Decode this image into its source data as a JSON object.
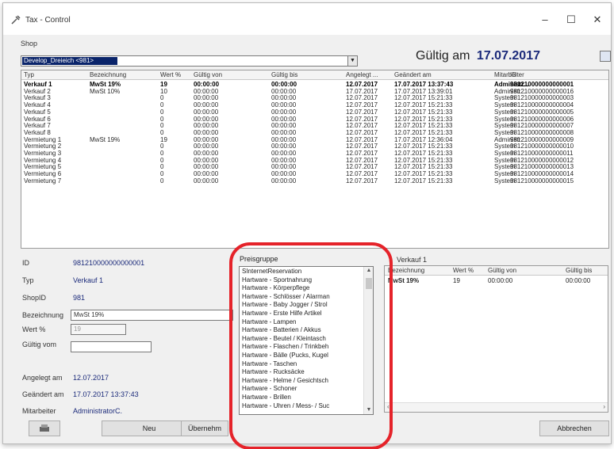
{
  "window": {
    "title": "Tax - Control",
    "minimize": "–",
    "maximize": "☐",
    "close": "✕"
  },
  "shop": {
    "label": "Shop",
    "selected": "Develop_Dreieich <981>"
  },
  "valid": {
    "label": "Gültig am",
    "date": "17.07.2017"
  },
  "grid": {
    "headers": [
      "Typ",
      "Bezeichnung",
      "Wert %",
      "Gültig von",
      "Gültig bis",
      "Angelegt ...",
      "Geändert am",
      "Mitarbeiter",
      "ID"
    ],
    "rows": [
      [
        "Verkauf 1",
        "MwSt 19%",
        "19",
        "00:00:00",
        "00:00:00",
        "12.07.2017",
        "17.07.2017 13:37:43",
        "Administr...",
        "981210000000000001"
      ],
      [
        "Verkauf 2",
        "MwSt 10%",
        "10",
        "00:00:00",
        "00:00:00",
        "17.07.2017",
        "17.07.2017 13:39:01",
        "Administr...",
        "981210000000000016"
      ],
      [
        "Verkauf 3",
        "",
        "0",
        "00:00:00",
        "00:00:00",
        "12.07.2017",
        "12.07.2017 15:21:33",
        "System",
        "981210000000000003"
      ],
      [
        "Verkauf 4",
        "",
        "0",
        "00:00:00",
        "00:00:00",
        "12.07.2017",
        "12.07.2017 15:21:33",
        "System",
        "981210000000000004"
      ],
      [
        "Verkauf 5",
        "",
        "0",
        "00:00:00",
        "00:00:00",
        "12.07.2017",
        "12.07.2017 15:21:33",
        "System",
        "981210000000000005"
      ],
      [
        "Verkauf 6",
        "",
        "0",
        "00:00:00",
        "00:00:00",
        "12.07.2017",
        "12.07.2017 15:21:33",
        "System",
        "981210000000000006"
      ],
      [
        "Verkauf 7",
        "",
        "0",
        "00:00:00",
        "00:00:00",
        "12.07.2017",
        "12.07.2017 15:21:33",
        "System",
        "981210000000000007"
      ],
      [
        "Verkauf 8",
        "",
        "0",
        "00:00:00",
        "00:00:00",
        "12.07.2017",
        "12.07.2017 15:21:33",
        "System",
        "981210000000000008"
      ],
      [
        "Vermietung 1",
        "MwSt 19%",
        "19",
        "00:00:00",
        "00:00:00",
        "12.07.2017",
        "17.07.2017 12:36:04",
        "Administr...",
        "981210000000000009"
      ],
      [
        "Vermietung 2",
        "",
        "0",
        "00:00:00",
        "00:00:00",
        "12.07.2017",
        "12.07.2017 15:21:33",
        "System",
        "981210000000000010"
      ],
      [
        "Vermietung 3",
        "",
        "0",
        "00:00:00",
        "00:00:00",
        "12.07.2017",
        "12.07.2017 15:21:33",
        "System",
        "981210000000000011"
      ],
      [
        "Vermietung 4",
        "",
        "0",
        "00:00:00",
        "00:00:00",
        "12.07.2017",
        "12.07.2017 15:21:33",
        "System",
        "981210000000000012"
      ],
      [
        "Vermietung 5",
        "",
        "0",
        "00:00:00",
        "00:00:00",
        "12.07.2017",
        "12.07.2017 15:21:33",
        "System",
        "981210000000000013"
      ],
      [
        "Vermietung 6",
        "",
        "0",
        "00:00:00",
        "00:00:00",
        "12.07.2017",
        "12.07.2017 15:21:33",
        "System",
        "981210000000000014"
      ],
      [
        "Vermietung 7",
        "",
        "0",
        "00:00:00",
        "00:00:00",
        "12.07.2017",
        "12.07.2017 15:21:33",
        "System",
        "981210000000000015"
      ]
    ]
  },
  "details": {
    "id_label": "ID",
    "id_value": "981210000000000001",
    "typ_label": "Typ",
    "typ_value": "Verkauf 1",
    "shopid_label": "ShopID",
    "shopid_value": "981",
    "bezeichnung_label": "Bezeichnung",
    "bezeichnung_value": "MwSt 19%",
    "wert_label": "Wert %",
    "wert_value": "19",
    "gueltig_label": "Gültig vom",
    "gueltig_value": "",
    "angelegt_label": "Angelegt am",
    "angelegt_value": "12.07.2017",
    "geaendert_label": "Geändert am",
    "geaendert_value": "17.07.2017 13:37:43",
    "mitarbeiter_label": "Mitarbeiter",
    "mitarbeiter_value": "AdministratorC."
  },
  "preisgruppe": {
    "label": "Preisgruppe",
    "items": [
      "SInternetReservation",
      "Hartware - Sportnahrung",
      "Hartware - Körperpflege",
      "Hartware - Schlösser / Alarman",
      "Hartware - Baby Jogger / Strol",
      "Hartware - Erste Hilfe Artikel",
      "Hartware - Lampen",
      "Hartware - Batterien / Akkus",
      "Hartware - Beutel / Kleintasch",
      "Hartware - Flaschen / Trinkbeh",
      "Hartware - Bälle (Pucks, Kugel",
      "Hartware - Taschen",
      "Hartware - Rucksäcke",
      "Hartware - Helme / Gesichtsch",
      "Hartware - Schoner",
      "Hartware - Brillen",
      "Hartware - Uhren / Mess- / Suc"
    ]
  },
  "right": {
    "title": "Verkauf 1",
    "headers": [
      "Bezeichnung",
      "Wert %",
      "Gültig von",
      "Gültig bis"
    ],
    "row": [
      "MwSt 19%",
      "19",
      "00:00:00",
      "00:00:00"
    ]
  },
  "buttons": {
    "neu": "Neu",
    "uebernehmen": "Übernehm",
    "abbrechen": "Abbrechen"
  },
  "colors": {
    "highlight": "#e5232a",
    "selection": "#0a246a",
    "accent_text": "#1b2a7a"
  }
}
